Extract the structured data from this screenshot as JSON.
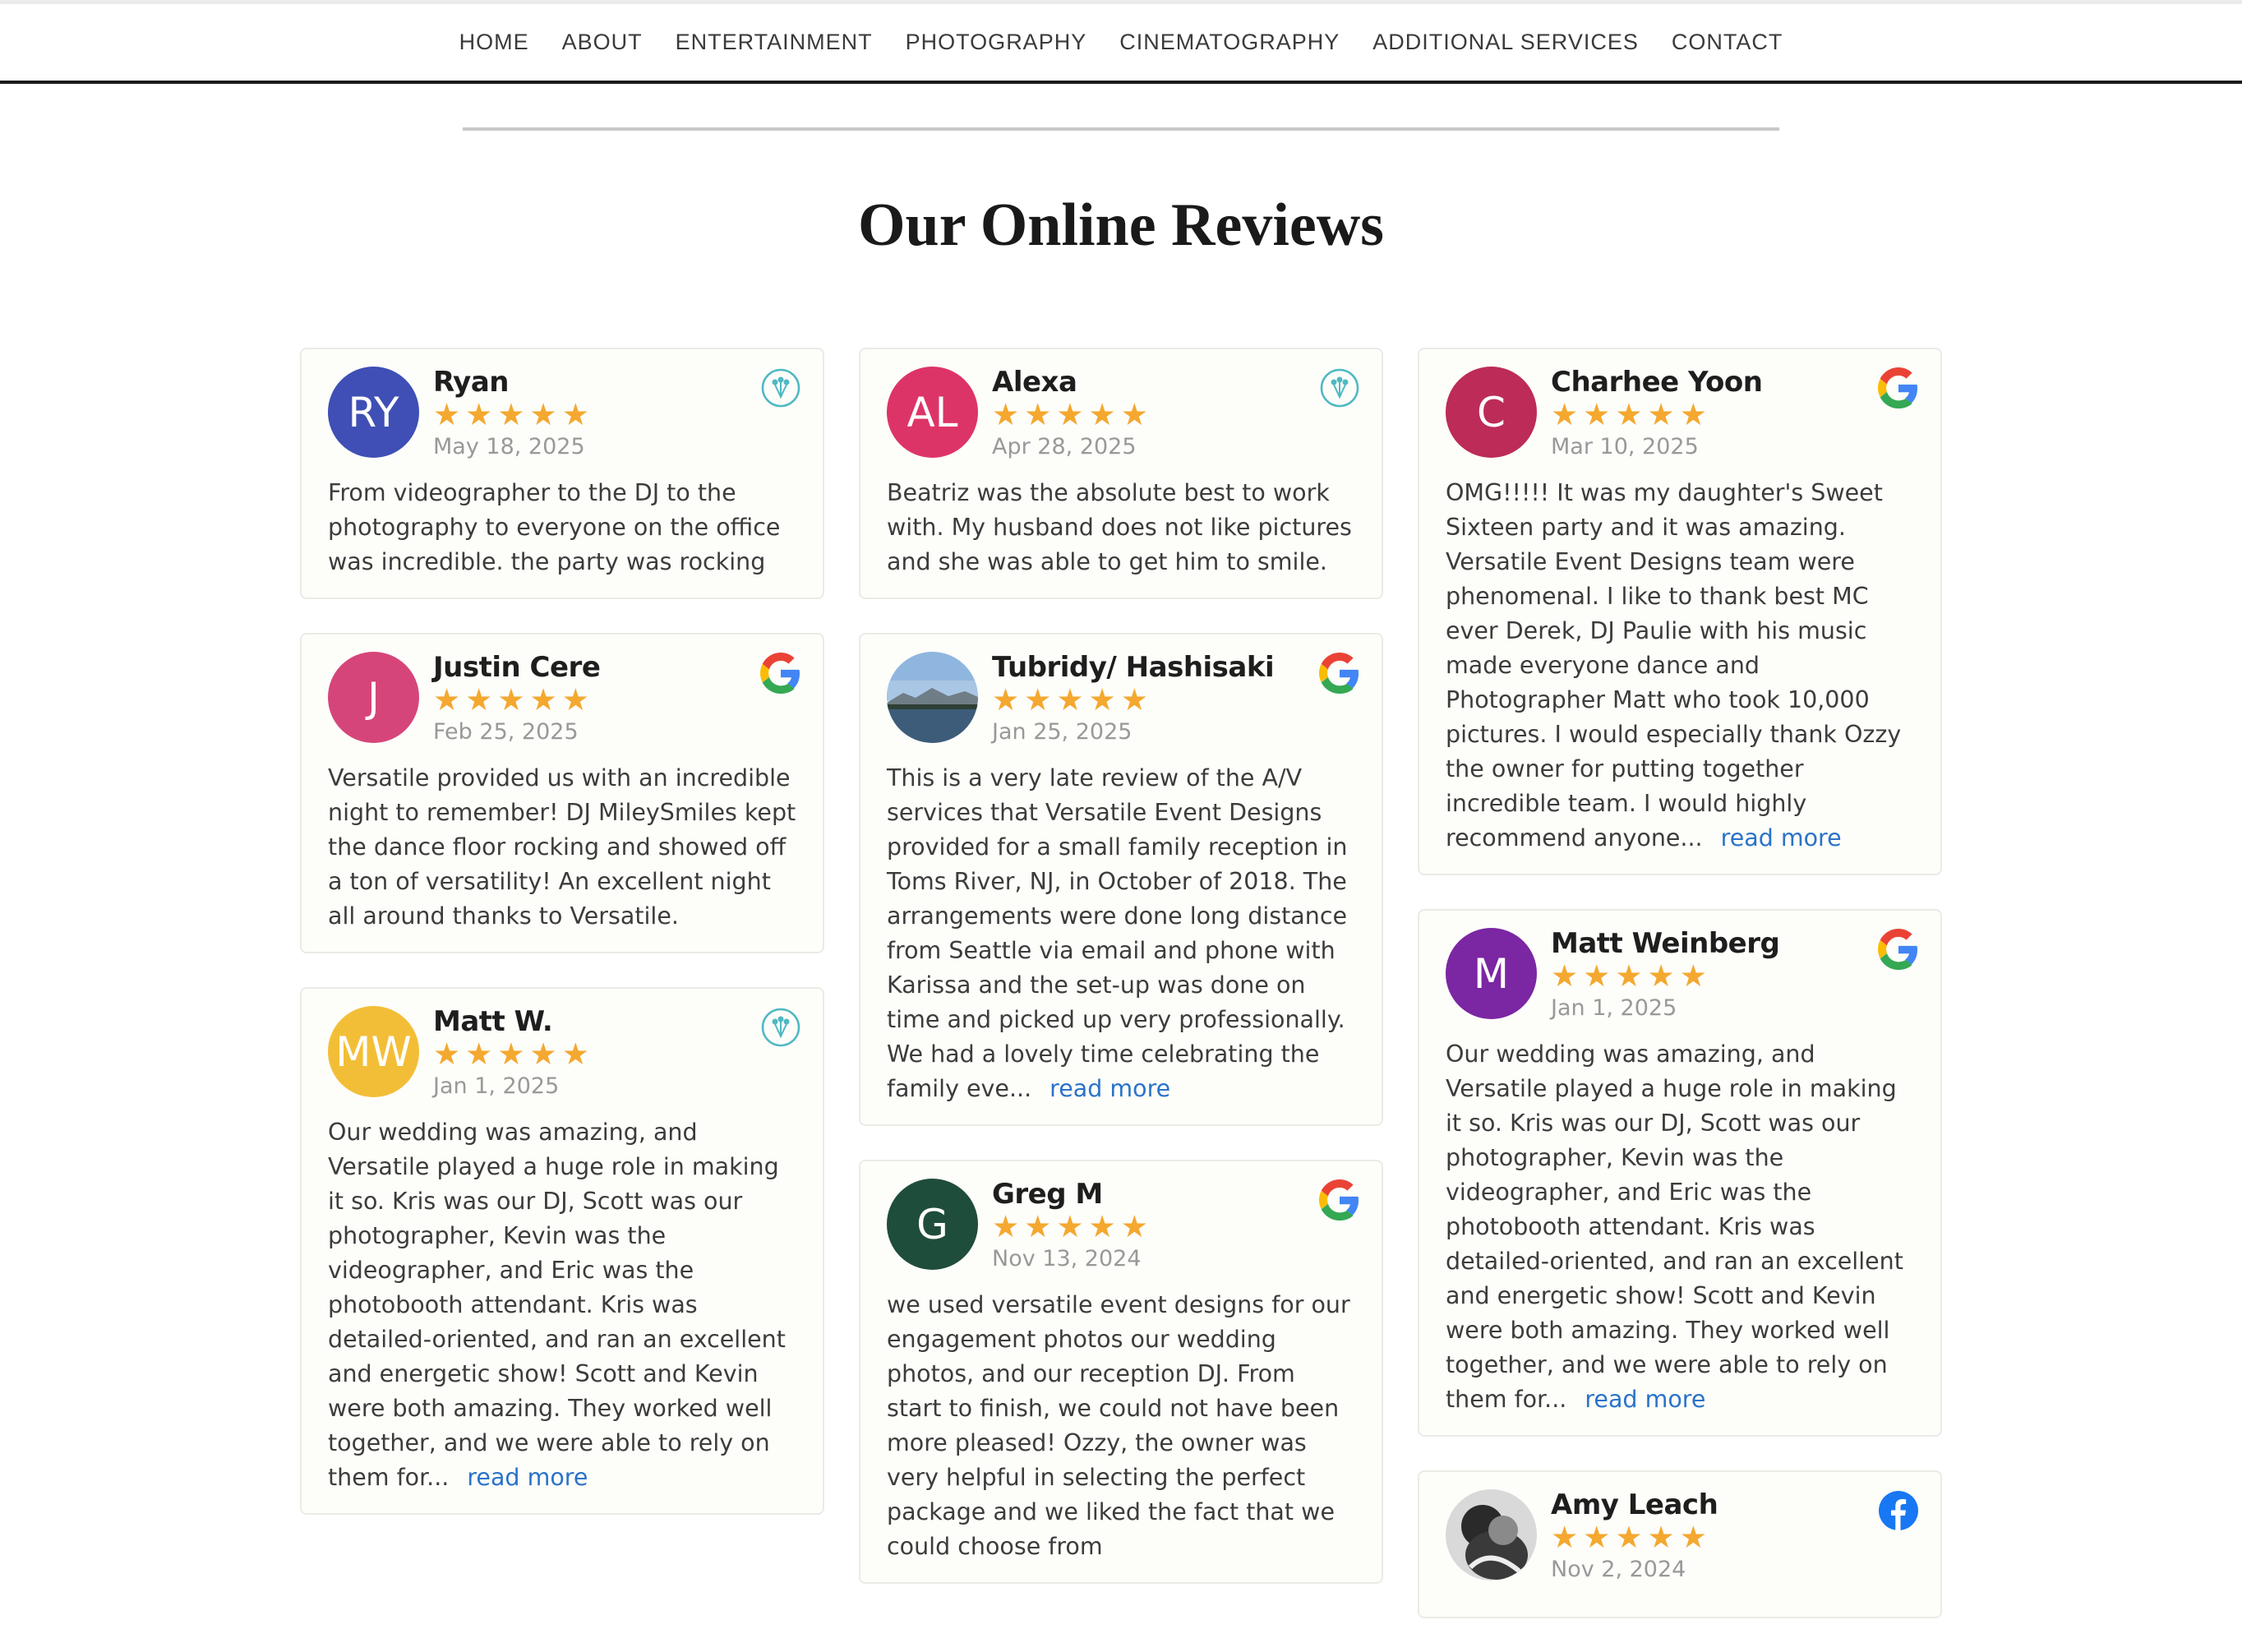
{
  "nav": {
    "items": [
      "HOME",
      "ABOUT",
      "ENTERTAINMENT",
      "PHOTOGRAPHY",
      "CINEMATOGRAPHY",
      "ADDITIONAL SERVICES",
      "CONTACT"
    ]
  },
  "main": {
    "title": "Our Online Reviews",
    "read_more_label": "read more",
    "reviews": [
      {
        "name": "Ryan",
        "initials": "RY",
        "avatar_color": "#3f4fb5",
        "source": "weddingwire-icon",
        "rating": 5,
        "date": "May 18, 2025",
        "text": "From videographer to the DJ to the photography to everyone on the office was incredible. the party was rocking"
      },
      {
        "name": "Justin Cere",
        "initials": "J",
        "avatar_color": "#d6457a",
        "source": "google-icon",
        "rating": 5,
        "date": "Feb 25, 2025",
        "text": "Versatile provided us with an incredible night to remember! DJ MileySmiles kept the dance floor rocking and showed off a ton of versatility! An excellent night all around thanks to Versatile."
      },
      {
        "name": "Matt W.",
        "initials": "MW",
        "avatar_color": "#f3be37",
        "source": "weddingwire-icon",
        "rating": 5,
        "date": "Jan 1, 2025",
        "text": "Our wedding was amazing, and Versatile played a huge role in making it so. Kris was our DJ, Scott was our photographer, Kevin was the videographer, and Eric was the photobooth attendant. Kris was detailed-oriented, and ran an excellent and energetic show! Scott and Kevin were both amazing. They worked well together, and we were able to rely on them for..."
      },
      {
        "name": "Alexa",
        "initials": "AL",
        "avatar_color": "#dd3467",
        "source": "weddingwire-icon",
        "rating": 5,
        "date": "Apr 28, 2025",
        "text": "Beatriz was the absolute best to work with. My husband does not like pictures and she was able to get him to smile."
      },
      {
        "name": "Tubridy/ Hashisaki",
        "initials": "",
        "avatar_color": "#7aa6cf",
        "source": "google-icon",
        "rating": 5,
        "date": "Jan 25, 2025",
        "text": "This is a very late review of the A/V services that Versatile Event Designs provided for a small family reception in Toms River, NJ, in October of 2018. The arrangements were done long distance from Seattle via email and phone with Karissa and the set-up was done on time and picked up very professionally. We had a lovely time celebrating the family eve..."
      },
      {
        "name": "Greg M",
        "initials": "G",
        "avatar_color": "#1f4d3b",
        "source": "google-icon",
        "rating": 5,
        "date": "Nov 13, 2024",
        "text": "we used versatile event designs for our engagement photos our wedding photos, and our reception DJ. From start to finish, we could not have been more pleased! Ozzy, the owner was very helpful in selecting the perfect package and we liked the fact that we could choose from"
      },
      {
        "name": "Charhee Yoon",
        "initials": "C",
        "avatar_color": "#bd2b58",
        "source": "google-icon",
        "rating": 5,
        "date": "Mar 10, 2025",
        "text": "OMG!!!!! It was my daughter's Sweet Sixteen party and it was amazing. Versatile Event Designs team were phenomenal. I like to thank best MC ever Derek, DJ Paulie with his music made everyone dance and Photographer Matt who took 10,000 pictures. I would especially thank Ozzy the owner for putting together incredible team. I would highly recommend anyone..."
      },
      {
        "name": "Matt Weinberg",
        "initials": "M",
        "avatar_color": "#7b26a3",
        "source": "google-icon",
        "rating": 5,
        "date": "Jan 1, 2025",
        "text": "Our wedding was amazing, and Versatile played a huge role in making it so. Kris was our DJ, Scott was our photographer, Kevin was the videographer, and Eric was the photobooth attendant. Kris was detailed-oriented, and ran an excellent and energetic show! Scott and Kevin were both amazing. They worked well together, and we were able to rely on them for..."
      },
      {
        "name": "Amy Leach",
        "initials": "",
        "avatar_color": "#5a5a5a",
        "source": "facebook-icon",
        "rating": 5,
        "date": "Nov 2, 2024",
        "text": ""
      }
    ]
  }
}
